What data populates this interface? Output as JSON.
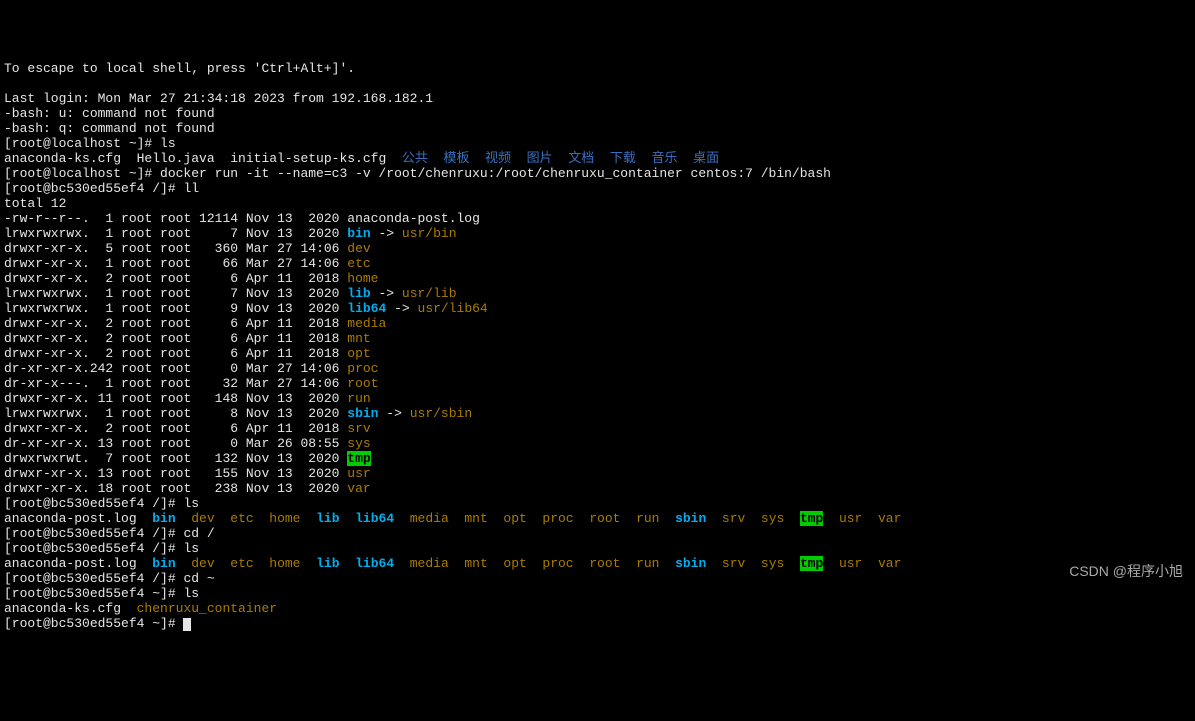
{
  "header": {
    "escape_msg": "To escape to local shell, press 'Ctrl+Alt+]'.",
    "blank": "",
    "last_login": "Last login: Mon Mar 27 21:34:18 2023 from 192.168.182.1",
    "bash_u": "-bash: u: command not found",
    "bash_q": "-bash: q: command not found"
  },
  "host_prompt1": {
    "prefix": "[root@localhost ~]# ",
    "cmd": "ls"
  },
  "host_ls": {
    "items": [
      {
        "t": "anaconda-ks.cfg  Hello.java  initial-setup-ks.cfg  ",
        "c": "w"
      },
      {
        "t": "公共  模板  视频  图片  文档  下载  音乐  桌面",
        "c": "blue"
      }
    ]
  },
  "host_prompt2": {
    "prefix": "[root@localhost ~]# ",
    "cmd": "docker run -it --name=c3 -v /root/chenruxu:/root/chenruxu_container centos:7 /bin/bash"
  },
  "cont_prompt_ll": {
    "prefix": "[root@bc530ed55ef4 /]# ",
    "cmd": "ll"
  },
  "ll_total": "total 12",
  "ll_rows": [
    {
      "perm": "-rw-r--r--.",
      "ln": "  1",
      "og": " root root",
      "sz": " 12114",
      "dt": " Nov 13  2020 ",
      "rest": [
        {
          "t": "anaconda-post.log",
          "c": "w"
        }
      ]
    },
    {
      "perm": "lrwxrwxrwx.",
      "ln": "  1",
      "og": " root root",
      "sz": "     7",
      "dt": " Nov 13  2020 ",
      "rest": [
        {
          "t": "bin",
          "c": "cyan"
        },
        {
          "t": " -> ",
          "c": "w"
        },
        {
          "t": "usr/bin",
          "c": "yellow"
        }
      ]
    },
    {
      "perm": "drwxr-xr-x.",
      "ln": "  5",
      "og": " root root",
      "sz": "   360",
      "dt": " Mar 27 14:06 ",
      "rest": [
        {
          "t": "dev",
          "c": "yellow"
        }
      ]
    },
    {
      "perm": "drwxr-xr-x.",
      "ln": "  1",
      "og": " root root",
      "sz": "    66",
      "dt": " Mar 27 14:06 ",
      "rest": [
        {
          "t": "etc",
          "c": "yellow"
        }
      ]
    },
    {
      "perm": "drwxr-xr-x.",
      "ln": "  2",
      "og": " root root",
      "sz": "     6",
      "dt": " Apr 11  2018 ",
      "rest": [
        {
          "t": "home",
          "c": "yellow"
        }
      ]
    },
    {
      "perm": "lrwxrwxrwx.",
      "ln": "  1",
      "og": " root root",
      "sz": "     7",
      "dt": " Nov 13  2020 ",
      "rest": [
        {
          "t": "lib",
          "c": "cyan"
        },
        {
          "t": " -> ",
          "c": "w"
        },
        {
          "t": "usr/lib",
          "c": "yellow"
        }
      ]
    },
    {
      "perm": "lrwxrwxrwx.",
      "ln": "  1",
      "og": " root root",
      "sz": "     9",
      "dt": " Nov 13  2020 ",
      "rest": [
        {
          "t": "lib64",
          "c": "cyan"
        },
        {
          "t": " -> ",
          "c": "w"
        },
        {
          "t": "usr/lib64",
          "c": "yellow"
        }
      ]
    },
    {
      "perm": "drwxr-xr-x.",
      "ln": "  2",
      "og": " root root",
      "sz": "     6",
      "dt": " Apr 11  2018 ",
      "rest": [
        {
          "t": "media",
          "c": "yellow"
        }
      ]
    },
    {
      "perm": "drwxr-xr-x.",
      "ln": "  2",
      "og": " root root",
      "sz": "     6",
      "dt": " Apr 11  2018 ",
      "rest": [
        {
          "t": "mnt",
          "c": "yellow"
        }
      ]
    },
    {
      "perm": "drwxr-xr-x.",
      "ln": "  2",
      "og": " root root",
      "sz": "     6",
      "dt": " Apr 11  2018 ",
      "rest": [
        {
          "t": "opt",
          "c": "yellow"
        }
      ]
    },
    {
      "perm": "dr-xr-xr-x.",
      "ln": "242",
      "og": " root root",
      "sz": "     0",
      "dt": " Mar 27 14:06 ",
      "rest": [
        {
          "t": "proc",
          "c": "yellow"
        }
      ]
    },
    {
      "perm": "dr-xr-x---.",
      "ln": "  1",
      "og": " root root",
      "sz": "    32",
      "dt": " Mar 27 14:06 ",
      "rest": [
        {
          "t": "root",
          "c": "yellow"
        }
      ]
    },
    {
      "perm": "drwxr-xr-x.",
      "ln": " 11",
      "og": " root root",
      "sz": "   148",
      "dt": " Nov 13  2020 ",
      "rest": [
        {
          "t": "run",
          "c": "yellow"
        }
      ]
    },
    {
      "perm": "lrwxrwxrwx.",
      "ln": "  1",
      "og": " root root",
      "sz": "     8",
      "dt": " Nov 13  2020 ",
      "rest": [
        {
          "t": "sbin",
          "c": "cyan"
        },
        {
          "t": " -> ",
          "c": "w"
        },
        {
          "t": "usr/sbin",
          "c": "yellow"
        }
      ]
    },
    {
      "perm": "drwxr-xr-x.",
      "ln": "  2",
      "og": " root root",
      "sz": "     6",
      "dt": " Apr 11  2018 ",
      "rest": [
        {
          "t": "srv",
          "c": "yellow"
        }
      ]
    },
    {
      "perm": "dr-xr-xr-x.",
      "ln": " 13",
      "og": " root root",
      "sz": "     0",
      "dt": " Mar 26 08:55 ",
      "rest": [
        {
          "t": "sys",
          "c": "yellow"
        }
      ]
    },
    {
      "perm": "drwxrwxrwt.",
      "ln": "  7",
      "og": " root root",
      "sz": "   132",
      "dt": " Nov 13  2020 ",
      "rest": [
        {
          "t": "tmp",
          "c": "green-b"
        }
      ]
    },
    {
      "perm": "drwxr-xr-x.",
      "ln": " 13",
      "og": " root root",
      "sz": "   155",
      "dt": " Nov 13  2020 ",
      "rest": [
        {
          "t": "usr",
          "c": "yellow"
        }
      ]
    },
    {
      "perm": "drwxr-xr-x.",
      "ln": " 18",
      "og": " root root",
      "sz": "   238",
      "dt": " Nov 13  2020 ",
      "rest": [
        {
          "t": "var",
          "c": "yellow"
        }
      ]
    }
  ],
  "cont_prompt_ls1": {
    "prefix": "[root@bc530ed55ef4 /]# ",
    "cmd": "ls"
  },
  "root_ls_items": [
    {
      "t": "anaconda-post.log  ",
      "c": "w"
    },
    {
      "t": "bin",
      "c": "cyan"
    },
    {
      "t": "  ",
      "c": "w"
    },
    {
      "t": "dev",
      "c": "yellow"
    },
    {
      "t": "  ",
      "c": "w"
    },
    {
      "t": "etc",
      "c": "yellow"
    },
    {
      "t": "  ",
      "c": "w"
    },
    {
      "t": "home",
      "c": "yellow"
    },
    {
      "t": "  ",
      "c": "w"
    },
    {
      "t": "lib",
      "c": "cyan"
    },
    {
      "t": "  ",
      "c": "w"
    },
    {
      "t": "lib64",
      "c": "cyan"
    },
    {
      "t": "  ",
      "c": "w"
    },
    {
      "t": "media",
      "c": "yellow"
    },
    {
      "t": "  ",
      "c": "w"
    },
    {
      "t": "mnt",
      "c": "yellow"
    },
    {
      "t": "  ",
      "c": "w"
    },
    {
      "t": "opt",
      "c": "yellow"
    },
    {
      "t": "  ",
      "c": "w"
    },
    {
      "t": "proc",
      "c": "yellow"
    },
    {
      "t": "  ",
      "c": "w"
    },
    {
      "t": "root",
      "c": "yellow"
    },
    {
      "t": "  ",
      "c": "w"
    },
    {
      "t": "run",
      "c": "yellow"
    },
    {
      "t": "  ",
      "c": "w"
    },
    {
      "t": "sbin",
      "c": "cyan"
    },
    {
      "t": "  ",
      "c": "w"
    },
    {
      "t": "srv",
      "c": "yellow"
    },
    {
      "t": "  ",
      "c": "w"
    },
    {
      "t": "sys",
      "c": "yellow"
    },
    {
      "t": "  ",
      "c": "w"
    },
    {
      "t": "tmp",
      "c": "green-b"
    },
    {
      "t": "  ",
      "c": "w"
    },
    {
      "t": "usr",
      "c": "yellow"
    },
    {
      "t": "  ",
      "c": "w"
    },
    {
      "t": "var",
      "c": "yellow"
    }
  ],
  "cont_prompt_cd1": {
    "prefix": "[root@bc530ed55ef4 /]# ",
    "cmd": "cd /"
  },
  "cont_prompt_ls2": {
    "prefix": "[root@bc530ed55ef4 /]# ",
    "cmd": "ls"
  },
  "cont_prompt_cd2": {
    "prefix": "[root@bc530ed55ef4 /]# ",
    "cmd": "cd ~"
  },
  "cont_prompt_ls3": {
    "prefix": "[root@bc530ed55ef4 ~]# ",
    "cmd": "ls"
  },
  "home_ls_items": [
    {
      "t": "anaconda-ks.cfg  ",
      "c": "w"
    },
    {
      "t": "chenruxu_container",
      "c": "yellow"
    }
  ],
  "cont_prompt_final": {
    "prefix": "[root@bc530ed55ef4 ~]# ",
    "cmd": ""
  },
  "watermark": "CSDN @程序小旭"
}
